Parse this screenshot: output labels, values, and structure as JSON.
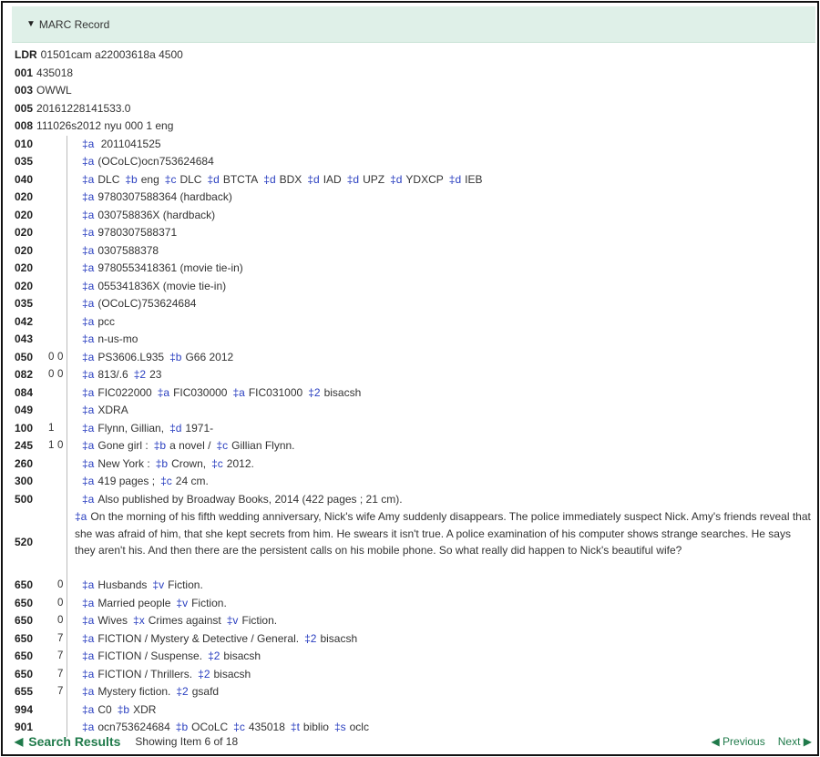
{
  "panel": {
    "title": "MARC Record"
  },
  "control_fields": [
    {
      "tag": "LDR",
      "value": "01501cam a22003618a 4500"
    },
    {
      "tag": "001",
      "value": "435018"
    },
    {
      "tag": "003",
      "value": "OWWL"
    },
    {
      "tag": "005",
      "value": "20161228141533.0"
    },
    {
      "tag": "008",
      "value": "111026s2012 nyu 000 1 eng"
    }
  ],
  "data_fields": [
    {
      "tag": "010",
      "ind1": "",
      "ind2": "",
      "subfields": [
        {
          "code": "‡a",
          "value": " 2011041525"
        }
      ]
    },
    {
      "tag": "035",
      "ind1": "",
      "ind2": "",
      "subfields": [
        {
          "code": "‡a",
          "value": "(OCoLC)ocn753624684"
        }
      ]
    },
    {
      "tag": "040",
      "ind1": "",
      "ind2": "",
      "subfields": [
        {
          "code": "‡a",
          "value": "DLC"
        },
        {
          "code": "‡b",
          "value": "eng"
        },
        {
          "code": "‡c",
          "value": "DLC"
        },
        {
          "code": "‡d",
          "value": "BTCTA"
        },
        {
          "code": "‡d",
          "value": "BDX"
        },
        {
          "code": "‡d",
          "value": "IAD"
        },
        {
          "code": "‡d",
          "value": "UPZ"
        },
        {
          "code": "‡d",
          "value": "YDXCP"
        },
        {
          "code": "‡d",
          "value": "IEB"
        }
      ]
    },
    {
      "tag": "020",
      "ind1": "",
      "ind2": "",
      "subfields": [
        {
          "code": "‡a",
          "value": "9780307588364 (hardback)"
        }
      ]
    },
    {
      "tag": "020",
      "ind1": "",
      "ind2": "",
      "subfields": [
        {
          "code": "‡a",
          "value": "030758836X (hardback)"
        }
      ]
    },
    {
      "tag": "020",
      "ind1": "",
      "ind2": "",
      "subfields": [
        {
          "code": "‡a",
          "value": "9780307588371"
        }
      ]
    },
    {
      "tag": "020",
      "ind1": "",
      "ind2": "",
      "subfields": [
        {
          "code": "‡a",
          "value": "0307588378"
        }
      ]
    },
    {
      "tag": "020",
      "ind1": "",
      "ind2": "",
      "subfields": [
        {
          "code": "‡a",
          "value": "9780553418361 (movie tie-in)"
        }
      ]
    },
    {
      "tag": "020",
      "ind1": "",
      "ind2": "",
      "subfields": [
        {
          "code": "‡a",
          "value": "055341836X (movie tie-in)"
        }
      ]
    },
    {
      "tag": "035",
      "ind1": "",
      "ind2": "",
      "subfields": [
        {
          "code": "‡a",
          "value": "(OCoLC)753624684"
        }
      ]
    },
    {
      "tag": "042",
      "ind1": "",
      "ind2": "",
      "subfields": [
        {
          "code": "‡a",
          "value": "pcc"
        }
      ]
    },
    {
      "tag": "043",
      "ind1": "",
      "ind2": "",
      "subfields": [
        {
          "code": "‡a",
          "value": "n-us-mo"
        }
      ]
    },
    {
      "tag": "050",
      "ind1": "0",
      "ind2": "0",
      "subfields": [
        {
          "code": "‡a",
          "value": "PS3606.L935"
        },
        {
          "code": "‡b",
          "value": "G66 2012"
        }
      ]
    },
    {
      "tag": "082",
      "ind1": "0",
      "ind2": "0",
      "subfields": [
        {
          "code": "‡a",
          "value": "813/.6"
        },
        {
          "code": "‡2",
          "value": "23"
        }
      ]
    },
    {
      "tag": "084",
      "ind1": "",
      "ind2": "",
      "subfields": [
        {
          "code": "‡a",
          "value": "FIC022000"
        },
        {
          "code": "‡a",
          "value": "FIC030000"
        },
        {
          "code": "‡a",
          "value": "FIC031000"
        },
        {
          "code": "‡2",
          "value": "bisacsh"
        }
      ]
    },
    {
      "tag": "049",
      "ind1": "",
      "ind2": "",
      "subfields": [
        {
          "code": "‡a",
          "value": "XDRA"
        }
      ]
    },
    {
      "tag": "100",
      "ind1": "1",
      "ind2": "",
      "subfields": [
        {
          "code": "‡a",
          "value": "Flynn, Gillian,"
        },
        {
          "code": "‡d",
          "value": "1971-"
        }
      ]
    },
    {
      "tag": "245",
      "ind1": "1",
      "ind2": "0",
      "subfields": [
        {
          "code": "‡a",
          "value": "Gone girl :"
        },
        {
          "code": "‡b",
          "value": "a novel /"
        },
        {
          "code": "‡c",
          "value": "Gillian Flynn."
        }
      ]
    },
    {
      "tag": "260",
      "ind1": "",
      "ind2": "",
      "subfields": [
        {
          "code": "‡a",
          "value": "New York :"
        },
        {
          "code": "‡b",
          "value": "Crown,"
        },
        {
          "code": "‡c",
          "value": "2012."
        }
      ]
    },
    {
      "tag": "300",
      "ind1": "",
      "ind2": "",
      "subfields": [
        {
          "code": "‡a",
          "value": "419 pages ;"
        },
        {
          "code": "‡c",
          "value": "24 cm."
        }
      ]
    },
    {
      "tag": "500",
      "ind1": "",
      "ind2": "",
      "subfields": [
        {
          "code": "‡a",
          "value": "Also published by Broadway Books, 2014 (422 pages ; 21 cm)."
        }
      ]
    },
    {
      "tag": "520",
      "ind1": "",
      "ind2": "",
      "tall": true,
      "subfields": [
        {
          "code": "‡a",
          "value": "On the morning of his fifth wedding anniversary, Nick's wife Amy suddenly disappears. The police immediately suspect Nick. Amy's friends reveal that she was afraid of him, that she kept secrets from him. He swears it isn't true. A police examination of his computer shows strange searches. He says they aren't his. And then there are the persistent calls on his mobile phone. So what really did happen to Nick's beautiful wife?"
        }
      ]
    },
    {
      "tag": "650",
      "ind1": "",
      "ind2": "0",
      "subfields": [
        {
          "code": "‡a",
          "value": "Husbands"
        },
        {
          "code": "‡v",
          "value": "Fiction."
        }
      ]
    },
    {
      "tag": "650",
      "ind1": "",
      "ind2": "0",
      "subfields": [
        {
          "code": "‡a",
          "value": "Married people"
        },
        {
          "code": "‡v",
          "value": "Fiction."
        }
      ]
    },
    {
      "tag": "650",
      "ind1": "",
      "ind2": "0",
      "subfields": [
        {
          "code": "‡a",
          "value": "Wives"
        },
        {
          "code": "‡x",
          "value": "Crimes against"
        },
        {
          "code": "‡v",
          "value": "Fiction."
        }
      ]
    },
    {
      "tag": "650",
      "ind1": "",
      "ind2": "7",
      "subfields": [
        {
          "code": "‡a",
          "value": "FICTION / Mystery & Detective / General."
        },
        {
          "code": "‡2",
          "value": "bisacsh"
        }
      ]
    },
    {
      "tag": "650",
      "ind1": "",
      "ind2": "7",
      "subfields": [
        {
          "code": "‡a",
          "value": "FICTION / Suspense."
        },
        {
          "code": "‡2",
          "value": "bisacsh"
        }
      ]
    },
    {
      "tag": "650",
      "ind1": "",
      "ind2": "7",
      "subfields": [
        {
          "code": "‡a",
          "value": "FICTION / Thrillers."
        },
        {
          "code": "‡2",
          "value": "bisacsh"
        }
      ]
    },
    {
      "tag": "655",
      "ind1": "",
      "ind2": "7",
      "subfields": [
        {
          "code": "‡a",
          "value": "Mystery fiction."
        },
        {
          "code": "‡2",
          "value": "gsafd"
        }
      ]
    },
    {
      "tag": "994",
      "ind1": "",
      "ind2": "",
      "subfields": [
        {
          "code": "‡a",
          "value": "C0"
        },
        {
          "code": "‡b",
          "value": "XDR"
        }
      ]
    },
    {
      "tag": "901",
      "ind1": "",
      "ind2": "",
      "subfields": [
        {
          "code": "‡a",
          "value": "ocn753624684"
        },
        {
          "code": "‡b",
          "value": "OCoLC"
        },
        {
          "code": "‡c",
          "value": "435018"
        },
        {
          "code": "‡t",
          "value": "biblio"
        },
        {
          "code": "‡s",
          "value": "oclc"
        }
      ]
    }
  ],
  "footer": {
    "back_label": "Search Results",
    "showing": "Showing Item 6 of 18",
    "previous_label": "Previous",
    "next_label": "Next"
  },
  "colors": {
    "accent": "#1f7a4a",
    "subfield": "#2a3fc0",
    "panel_bg": "#dff0e8"
  }
}
